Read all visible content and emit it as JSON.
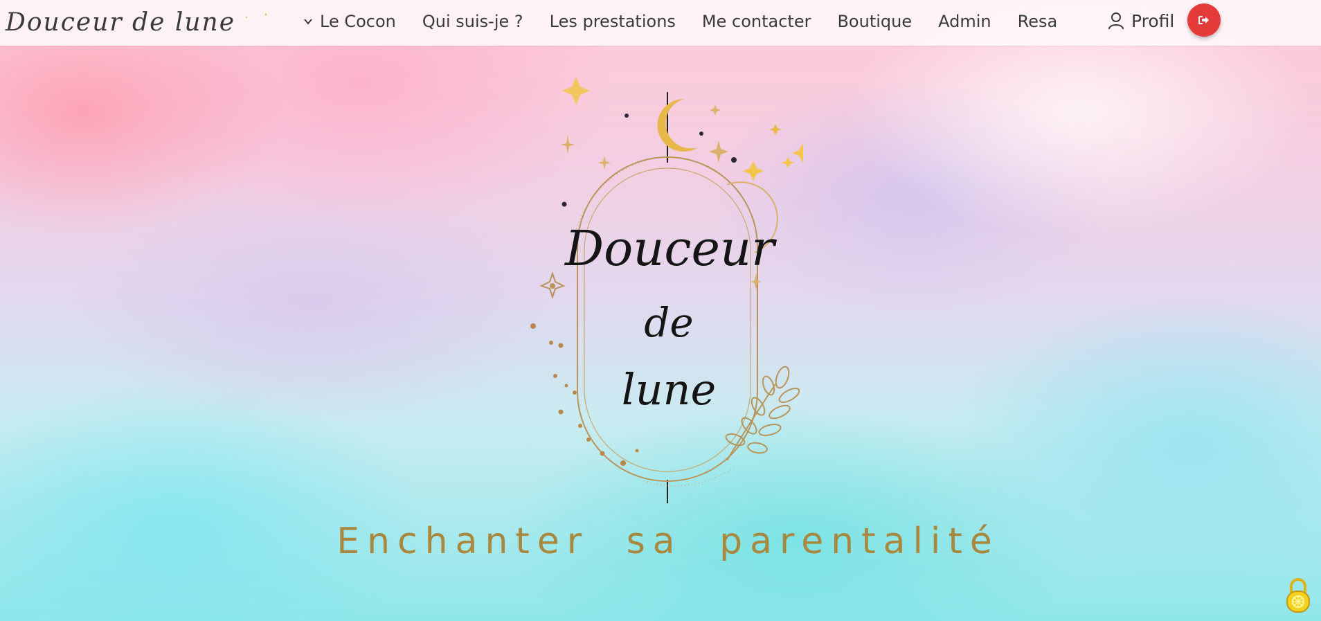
{
  "brand": {
    "name": "Douceur de lune",
    "logo_icon": "crescent-moon-icon"
  },
  "nav": {
    "items": [
      {
        "label": "Le Cocon",
        "has_dropdown": true
      },
      {
        "label": "Qui suis-je ?"
      },
      {
        "label": "Les prestations"
      },
      {
        "label": "Me contacter"
      },
      {
        "label": "Boutique"
      },
      {
        "label": "Admin"
      },
      {
        "label": "Resa"
      }
    ],
    "profile_label": "Profil",
    "profile_icon": "user-icon",
    "logout_icon": "sign-out-icon"
  },
  "hero": {
    "logo_lines": [
      "Douceur",
      "de",
      "lune"
    ],
    "tagline": "Enchanter sa parentalité"
  },
  "colors": {
    "accent_gold": "#a8883f",
    "moon_gold": "#e8b94a",
    "logout_red": "#e53a3a"
  },
  "floating_icon": "lock-icon"
}
